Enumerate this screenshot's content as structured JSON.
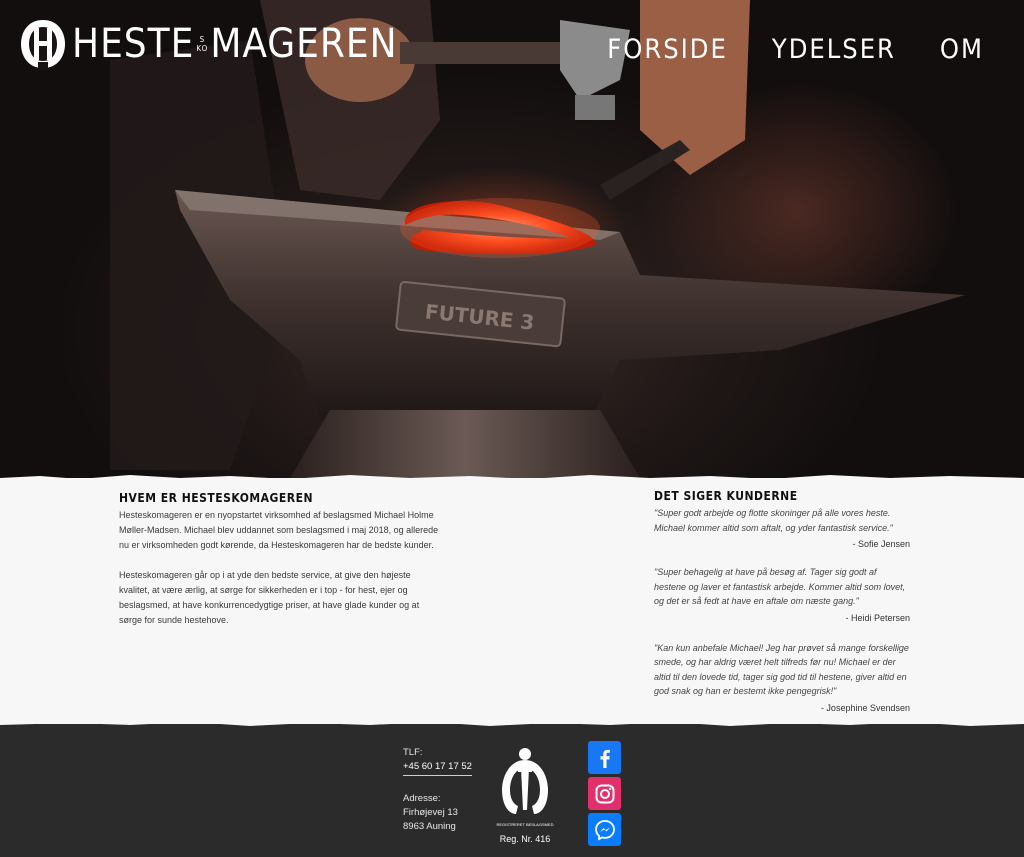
{
  "brand": {
    "name_left": "HESTE",
    "name_small_1": "S",
    "name_small_2": "KO",
    "name_right": "MAGEREN"
  },
  "nav": {
    "items": [
      {
        "label": "FORSIDE"
      },
      {
        "label": "YDELSER"
      },
      {
        "label": "OM"
      }
    ]
  },
  "hero": {
    "anvil_text": "FUTURE 3"
  },
  "about": {
    "title": "HVEM ER HESTESKOMAGEREN",
    "paragraph_1": "Hesteskomageren er en nyopstartet virksomhed af beslagsmed Michael Holme Møller-Madsen. Michael blev uddannet som beslagsmed i maj 2018, og allerede nu er virksomheden godt kørende, da Hesteskomageren har de bedste kunder.",
    "paragraph_2": "Hesteskomageren går op i at yde den bedste service, at give den højeste kvalitet, at være ærlig, at sørge for sikkerheden er i top - for hest, ejer og beslagsmed, at have konkurrencedygtige priser, at have glade kunder og at sørge for sunde hestehove."
  },
  "reviews": {
    "title": "DET SIGER KUNDERNE",
    "items": [
      {
        "quote": "\"Super godt arbejde og flotte skoninger på alle vores heste. Michael kommer altid som aftalt, og yder fantastisk service.\"",
        "author": "- Sofie Jensen"
      },
      {
        "quote": "\"Super behagelig at have på besøg af. Tager sig godt af hestene og laver et fantastisk arbejde. Kommer altid som lovet, og det er så fedt at have en aftale om næste gang.\"",
        "author": "- Heidi Petersen"
      },
      {
        "quote": "\"Kan kun anbefale Michael! Jeg har prøvet så mange forskellige smede, og har aldrig været helt tilfreds før nu! Michael er der altid til den lovede tid, tager sig god tid til hestene, giver altid en god snak og han er bestemt ikke pengegrisk!\"",
        "author": "- Josephine Svendsen"
      }
    ]
  },
  "footer": {
    "phone_label": "TLF:",
    "phone": "+45 60 17 17 52",
    "address_label": "Adresse:",
    "address_line_1": "Firhøjevej 13",
    "address_line_2": "8963 Auning",
    "badge_caption": "REGISTRERET BESLAGSMED",
    "reg_number": "Reg. Nr. 416",
    "social": [
      {
        "icon": "facebook-icon",
        "color": "#1877f2"
      },
      {
        "icon": "instagram-icon",
        "color": "#e1306c"
      },
      {
        "icon": "messenger-icon",
        "color": "#0a7cff"
      }
    ]
  },
  "colors": {
    "content_bg": "#f7f7f7",
    "footer_bg": "#2b2b2b",
    "hot_iron": "#ff4b1f"
  }
}
